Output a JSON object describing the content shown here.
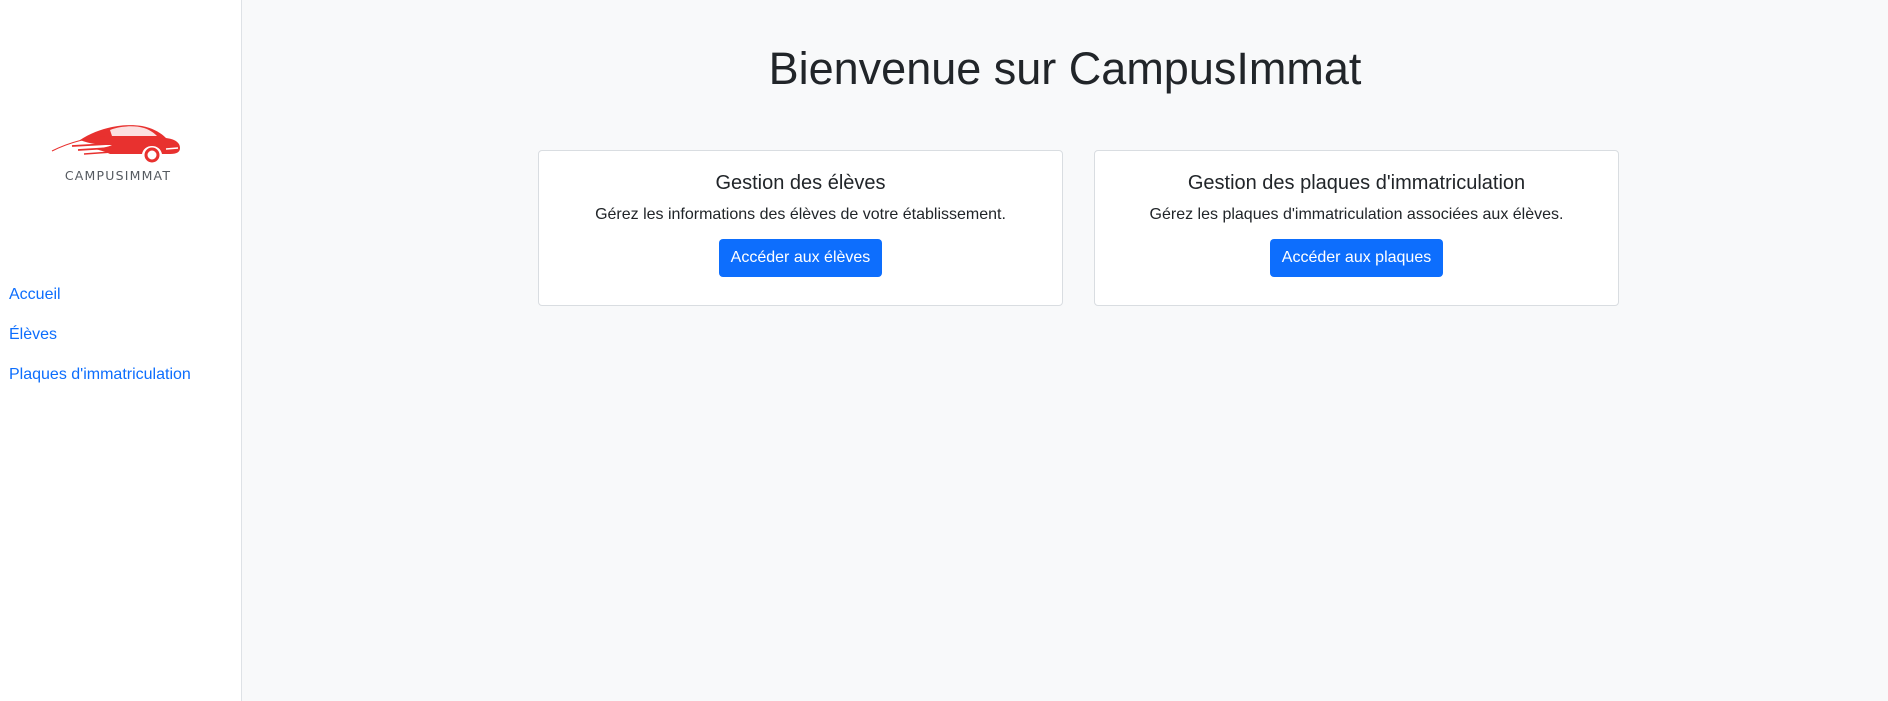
{
  "sidebar": {
    "logo_text": "CAMPUSIMMAT",
    "items": [
      {
        "label": "Accueil"
      },
      {
        "label": "Élèves"
      },
      {
        "label": "Plaques d'immatriculation"
      }
    ]
  },
  "main": {
    "title": "Bienvenue sur CampusImmat",
    "cards": [
      {
        "title": "Gestion des élèves",
        "text": "Gérez les informations des élèves de votre établissement.",
        "button": "Accéder aux élèves"
      },
      {
        "title": "Gestion des plaques d'immatriculation",
        "text": "Gérez les plaques d'immatriculation associées aux élèves.",
        "button": "Accéder aux plaques"
      }
    ]
  },
  "colors": {
    "accent": "#0d6efd",
    "logo": "#e8312f",
    "background": "#f8f9fa"
  }
}
